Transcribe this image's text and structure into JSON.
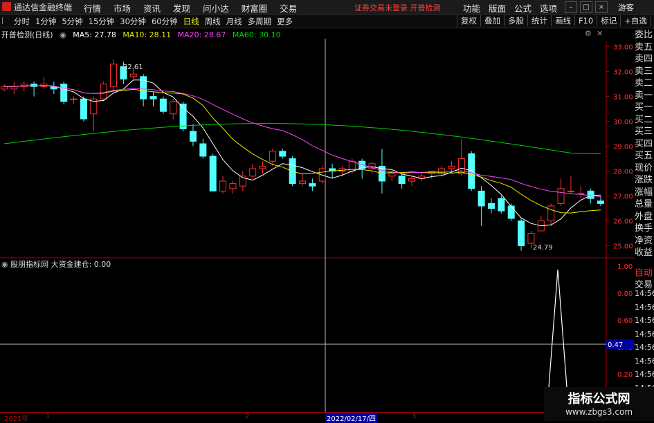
{
  "titlebar": {
    "app_name": "通达信金融终端",
    "menus": [
      "行情",
      "市场",
      "资讯",
      "发现",
      "问小达",
      "财富圈",
      "交易"
    ],
    "trade_status": "证券交易未登录  开普检测",
    "right_menus": [
      "功能",
      "版面",
      "公式",
      "选项"
    ],
    "guest": "游客"
  },
  "periodbar": {
    "items": [
      "分时",
      "1分钟",
      "5分钟",
      "15分钟",
      "30分钟",
      "60分钟",
      "日线",
      "周线",
      "月线",
      "多周期",
      "更多"
    ],
    "active": "日线",
    "tools": [
      "复权",
      "叠加",
      "多股",
      "统计",
      "画线",
      "F10",
      "标记",
      "+自选",
      "返回"
    ]
  },
  "main_chart": {
    "title": "开普检测(日线)",
    "ma5": "MA5: 27.78",
    "ma10": "MA10: 28.11",
    "ma20": "MA20: 28.67",
    "ma60": "MA60: 30.10",
    "high_label": "32.61",
    "low_label": "24.79",
    "price_axis": [
      "33.00",
      "32.00",
      "31.00",
      "30.00",
      "29.00",
      "28.00",
      "27.00",
      "26.00",
      "25.00"
    ],
    "colors": {
      "up": "#ff3030",
      "down": "#54ffff",
      "ma5": "#ffffff",
      "ma10": "#e8e800",
      "ma20": "#ff40ff",
      "ma60": "#00d000"
    }
  },
  "indicator": {
    "name": "股朋指标网",
    "label": "大资金建仓: 0.00",
    "axis": [
      "1.00",
      "0.80",
      "0.60",
      "0.40",
      "0.20"
    ],
    "cursor_value": "0.47"
  },
  "quote_panel": {
    "items": [
      "委比",
      "卖五",
      "卖四",
      "卖三",
      "卖二",
      "卖一",
      "买一",
      "买二",
      "买三",
      "买四",
      "买五",
      "现价",
      "涨跌",
      "涨幅",
      "总量",
      "外盘",
      "换手",
      "净资",
      "收益"
    ],
    "lower_items": [
      "自动",
      "交易",
      "14:56",
      "14:56",
      "14:56",
      "14:56",
      "14:56",
      "14:56",
      "14:56",
      "14:56",
      "14:56"
    ]
  },
  "bottombar": {
    "year": "2021年",
    "ticks": [
      "1",
      "2",
      "3"
    ],
    "cursor_date": "2022/02/17/四"
  },
  "watermark": {
    "title": "指标公式网",
    "url": "www.zbgs3.com"
  },
  "chart_data": {
    "type": "candlestick",
    "ylim": [
      24.6,
      33.6
    ],
    "candles": [
      [
        31.3,
        31.5,
        31.2,
        31.4
      ],
      [
        31.3,
        31.6,
        31.1,
        31.4
      ],
      [
        31.4,
        31.6,
        31.2,
        31.5
      ],
      [
        31.5,
        31.6,
        31.0,
        31.4
      ],
      [
        31.4,
        31.8,
        31.3,
        31.5
      ],
      [
        31.4,
        31.6,
        31.1,
        31.3
      ],
      [
        31.5,
        31.6,
        30.7,
        30.8
      ],
      [
        30.9,
        31.0,
        30.7,
        30.9
      ],
      [
        30.9,
        31.0,
        30.0,
        30.1
      ],
      [
        30.3,
        31.0,
        29.6,
        30.9
      ],
      [
        30.9,
        31.6,
        30.8,
        31.5
      ],
      [
        31.4,
        32.5,
        31.2,
        32.3
      ],
      [
        32.2,
        32.4,
        31.5,
        31.7
      ],
      [
        31.8,
        32.1,
        31.7,
        31.9
      ],
      [
        31.8,
        31.9,
        30.6,
        30.9
      ],
      [
        31.0,
        31.2,
        30.6,
        30.9
      ],
      [
        30.9,
        31.0,
        30.3,
        30.4
      ],
      [
        30.3,
        30.9,
        30.1,
        30.8
      ],
      [
        30.7,
        30.8,
        29.6,
        29.7
      ],
      [
        29.6,
        29.9,
        29.0,
        29.2
      ],
      [
        29.1,
        29.3,
        28.5,
        28.6
      ],
      [
        28.6,
        28.7,
        27.2,
        27.2
      ],
      [
        27.2,
        27.8,
        27.1,
        27.6
      ],
      [
        27.3,
        27.6,
        27.1,
        27.5
      ],
      [
        27.4,
        28.0,
        27.2,
        27.8
      ],
      [
        27.8,
        28.3,
        27.7,
        28.1
      ],
      [
        28.1,
        28.4,
        27.9,
        28.2
      ],
      [
        28.4,
        28.9,
        28.2,
        28.8
      ],
      [
        28.8,
        28.9,
        28.5,
        28.6
      ],
      [
        28.5,
        28.6,
        27.4,
        27.5
      ],
      [
        27.5,
        27.9,
        27.4,
        27.6
      ],
      [
        27.5,
        27.7,
        27.2,
        27.4
      ],
      [
        27.6,
        28.2,
        27.5,
        28.1
      ],
      [
        28.1,
        28.3,
        27.7,
        28.0
      ],
      [
        28.0,
        28.2,
        27.8,
        28.1
      ],
      [
        28.0,
        28.5,
        27.9,
        28.4
      ],
      [
        28.4,
        28.5,
        27.7,
        28.1
      ],
      [
        28.1,
        28.4,
        27.9,
        28.3
      ],
      [
        28.2,
        28.9,
        27.1,
        27.6
      ],
      [
        27.8,
        28.0,
        27.6,
        27.9
      ],
      [
        27.8,
        27.9,
        27.3,
        27.5
      ],
      [
        27.6,
        27.8,
        27.4,
        27.7
      ],
      [
        27.7,
        27.9,
        27.6,
        27.8
      ],
      [
        27.9,
        28.0,
        27.7,
        28.0
      ],
      [
        27.9,
        28.2,
        27.8,
        28.1
      ],
      [
        28.1,
        28.4,
        27.9,
        28.2
      ],
      [
        27.9,
        29.3,
        27.8,
        28.5
      ],
      [
        28.7,
        28.8,
        27.2,
        27.3
      ],
      [
        27.2,
        27.4,
        25.8,
        26.6
      ],
      [
        26.7,
        26.9,
        26.3,
        26.5
      ],
      [
        26.9,
        27.0,
        26.3,
        26.4
      ],
      [
        26.6,
        26.7,
        26.0,
        26.1
      ],
      [
        26.0,
        26.1,
        24.8,
        25.0
      ],
      [
        25.1,
        25.6,
        24.9,
        25.5
      ],
      [
        25.6,
        26.2,
        25.6,
        26.0
      ],
      [
        26.0,
        26.7,
        25.8,
        26.6
      ],
      [
        26.7,
        27.7,
        26.6,
        27.3
      ],
      [
        27.2,
        27.8,
        27.1,
        27.2
      ],
      [
        27.1,
        27.4,
        26.9,
        27.1
      ],
      [
        27.2,
        27.3,
        26.7,
        26.9
      ],
      [
        26.8,
        27.0,
        26.6,
        26.7
      ]
    ]
  }
}
